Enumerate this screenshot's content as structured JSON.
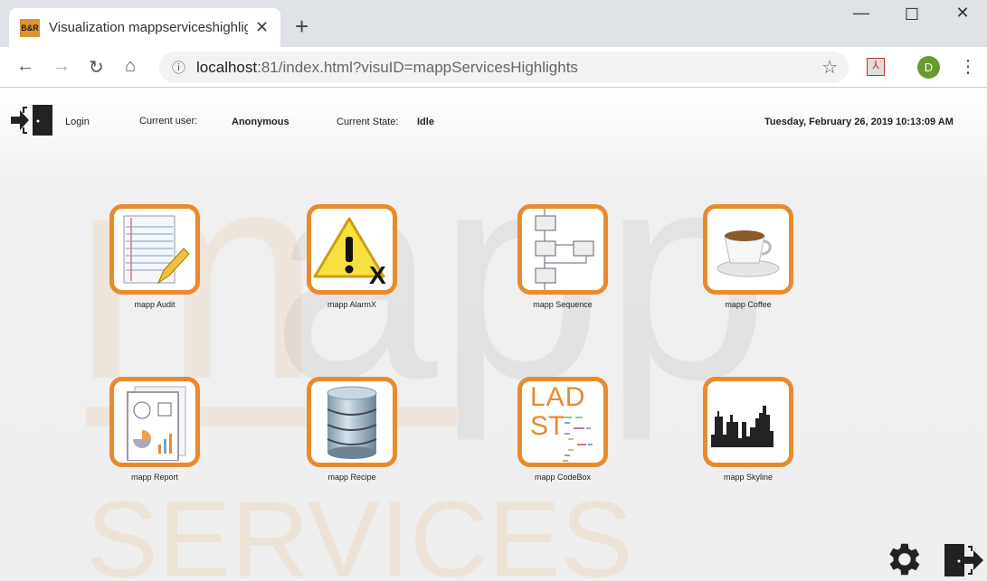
{
  "browser": {
    "tab_title": "Visualization mappserviceshighlights",
    "favicon_text": "B&R",
    "url_host": "localhost",
    "url_rest": ":81/index.html?visuID=mappServicesHighlights",
    "profile_initial": "D"
  },
  "header": {
    "login_label": "Login",
    "current_user_label": "Current user:",
    "current_user": "Anonymous",
    "current_state_label": "Current State:",
    "current_state": "Idle",
    "datetime": "Tuesday, February 26, 2019 10:13:09 AM"
  },
  "background": {
    "word1": "mapp",
    "word2": "SERVICES"
  },
  "tiles": [
    {
      "label": "mapp Audit",
      "icon": "notepad-pencil-icon"
    },
    {
      "label": "mapp AlarmX",
      "icon": "warning-icon"
    },
    {
      "label": "mapp Sequence",
      "icon": "sequence-chart-icon"
    },
    {
      "label": "mapp Coffee",
      "icon": "coffee-cup-icon"
    },
    {
      "label": "mapp Report",
      "icon": "report-icon"
    },
    {
      "label": "mapp Recipe",
      "icon": "database-icon"
    },
    {
      "label": "mapp CodeBox",
      "icon": "codebox-icon"
    },
    {
      "label": "mapp Skyline",
      "icon": "skyline-icon"
    }
  ],
  "codebox_text": {
    "line1": "LAD",
    "line2": "ST"
  },
  "colors": {
    "accent": "#e88a2e"
  }
}
